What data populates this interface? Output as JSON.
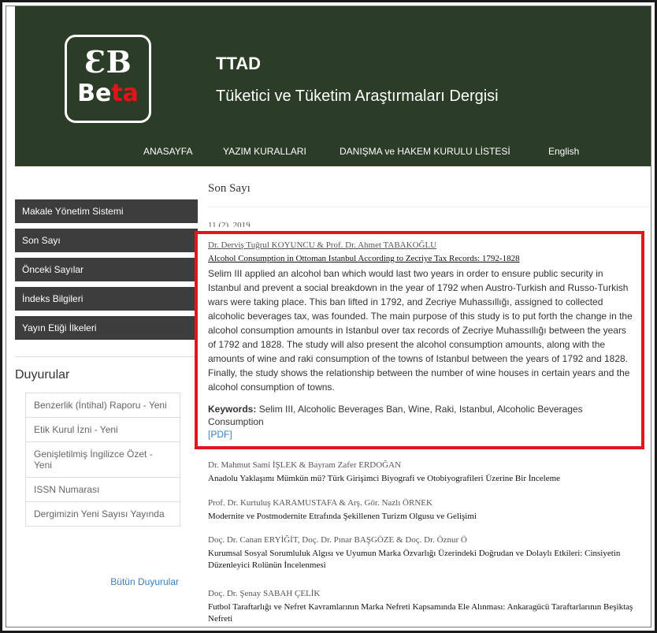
{
  "header": {
    "logo_mark": "ƐB",
    "logo_word_a": "Be",
    "logo_word_b": "ta",
    "site_code": "TTAD",
    "site_name": "Tüketici ve Tüketim Araştırmaları Dergisi"
  },
  "nav": {
    "items": [
      "ANASAYFA",
      "YAZIM KURALLARI",
      "DANIŞMA ve HAKEM KURULU LİSTESİ",
      "English"
    ]
  },
  "sidebar": {
    "menu": [
      "Makale Yönetim Sistemi",
      "Son Sayı",
      "Önceki Sayılar",
      "İndeks Bilgileri",
      "Yayın Etiği İlkeleri"
    ],
    "announcements_title": "Duyurular",
    "announcements": [
      "Benzerlik (İntihal) Raporu - Yeni",
      "Etik Kurul İzni - Yeni",
      "Genişletilmiş İngilizce Özet - Yeni",
      "ISSN Numarası",
      "Dergimizin Yeni Sayısı Yayında"
    ],
    "all_announcements": "Bütün Duyurular"
  },
  "main": {
    "title": "Son Sayı",
    "issue": "11 (2), 2019",
    "articles": [
      {
        "authors": "Dr. Derviş Tuğrul KOYUNCU & Prof. Dr. Ahmet TABAKOĞLU",
        "title": "Alcohol Consumption in Ottoman Istanbul According to Zecriye Tax Records: 1792-1828",
        "abstract": "Selim III applied an alcohol ban which would last two years in order to ensure public security in Istanbul and prevent a social breakdown in the year of 1792 when Austro-Turkish and Russo-Turkish wars were taking place. This ban lifted in 1792, and Zecriye Muhassıllığı, assigned to collected alcoholic beverages tax, was founded. The main purpose of this study is to put forth the change in the alcohol consumption amounts in Istanbul over tax records of Zecriye Muhassıllığı between the years of 1792 and 1828. The study will also present the alcohol consumption amounts, along with the amounts of wine and raki consumption of the towns of Istanbul between the years of 1792 and 1828. Finally, the study shows the relationship between the number of wine houses in certain years and the alcohol consumption of towns.",
        "keywords_label": "Keywords:",
        "keywords": "Selim III, Alcoholic Beverages Ban, Wine, Raki, Istanbul, Alcoholic Beverages Consumption",
        "pdf": "[PDF]"
      },
      {
        "authors": "Dr. Mahmut Sami İŞLEK & Bayram Zafer ERDOĞAN",
        "title": "Anadolu Yaklaşımı Mümkün mü? Türk Girişimci Biyografi ve Otobiyografileri Üzerine Bir İnceleme"
      },
      {
        "authors": "Prof. Dr. Kurtuluş KARAMUSTAFA & Arş. Gör. Nazlı ÖRNEK",
        "title": "Modernite ve Postmodernite Etrafında Şekillenen Turizm Olgusu ve Gelişimi"
      },
      {
        "authors": "Doç. Dr. Canan ERYİĞİT, Doç. Dr. Pınar BAŞGÖZE & Doç. Dr. Öznur Ö",
        "title": "Kurumsal Sosyal Sorumluluk Algısı ve Uyumun Marka Özvarlığı Üzerindeki Doğrudan ve Dolaylı Etkileri: Cinsiyetin Düzenleyici Rolünün İncelenmesi"
      },
      {
        "authors": "Doç. Dr. Şenay SABAH ÇELİK",
        "title": "Futbol Taraftarlığı ve Nefret Kavramlarının Marka Nefreti Kapsamında Ele Alınması: Ankaragücü Taraftarlarının Beşiktaş Nefreti"
      }
    ]
  },
  "colors": {
    "header_bg": "#2b3d27",
    "menu_bg": "#3d3d3d",
    "highlight": "#e4141c",
    "link": "#3a7fc1",
    "logo_accent": "#e1141a"
  }
}
